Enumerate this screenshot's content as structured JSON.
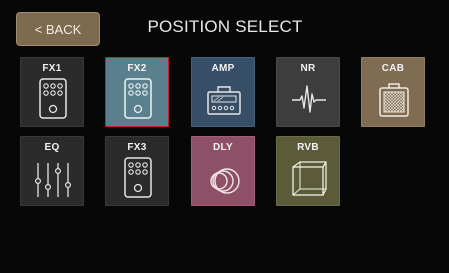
{
  "header": {
    "back_label": "< BACK",
    "title": "POSITION SELECT"
  },
  "tiles": [
    {
      "label": "FX1",
      "icon": "stompbox-icon",
      "color": "#2b2b2b"
    },
    {
      "label": "FX2",
      "icon": "stompbox-icon",
      "color": "#5a808e",
      "selected": true,
      "selected_border": "#c9202a"
    },
    {
      "label": "AMP",
      "icon": "amp-head-icon",
      "color": "#364e66"
    },
    {
      "label": "NR",
      "icon": "noise-waveform-icon",
      "color": "#3d3d3d"
    },
    {
      "label": "CAB",
      "icon": "speaker-cabinet-icon",
      "color": "#7f6c52"
    },
    {
      "label": "EQ",
      "icon": "eq-sliders-icon",
      "color": "#2b2b2b"
    },
    {
      "label": "FX3",
      "icon": "stompbox-icon",
      "color": "#2b2b2b"
    },
    {
      "label": "DLY",
      "icon": "delay-circles-icon",
      "color": "#8e5067"
    },
    {
      "label": "RVB",
      "icon": "reverb-cube-icon",
      "color": "#5b5b3a"
    }
  ]
}
